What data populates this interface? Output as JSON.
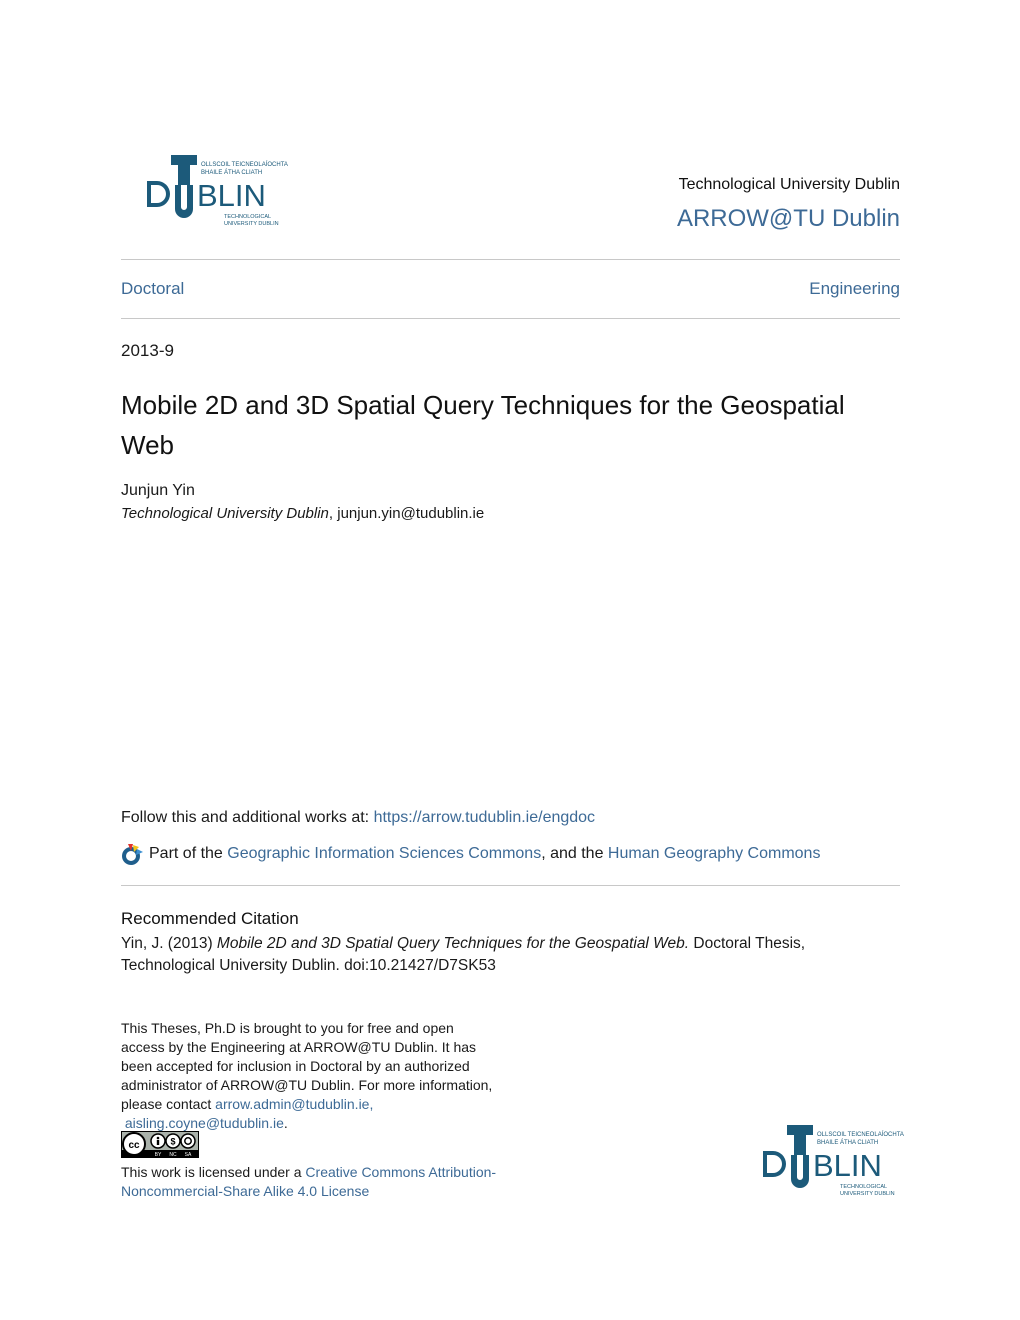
{
  "header": {
    "logo": {
      "icon": "tu-dublin-logo",
      "wordmark": "DUBLIN",
      "irish_line_1": "OLLSCOIL TEICNEOLAÍOCHTA",
      "irish_line_2": "BHAILE ÁTHA CLIATH",
      "english_line_1": "TECHNOLOGICAL",
      "english_line_2": "UNIVERSITY DUBLIN",
      "brand_color": "#1c5a7a"
    },
    "institution": "Technological University Dublin",
    "repository": "ARROW@TU Dublin"
  },
  "nav": {
    "left": "Doctoral",
    "right": "Engineering"
  },
  "document": {
    "date": "2013-9",
    "title": "Mobile 2D and 3D Spatial Query Techniques for the Geospatial Web",
    "author": "Junjun Yin",
    "affiliation": "Technological University Dublin",
    "affiliation_sep": ", ",
    "email": "junjun.yin@tudublin.ie"
  },
  "follow": {
    "label": "Follow this and additional works at: ",
    "url": "https://arrow.tudublin.ie/engdoc"
  },
  "part_of": {
    "icon": "digital-commons-network-icon",
    "prefix": "Part of the ",
    "link1": "Geographic Information Sciences Commons",
    "middle": ", and the ",
    "link2": "Human Geography Commons"
  },
  "citation": {
    "heading": "Recommended Citation",
    "prefix": "Yin, J. (2013) ",
    "title_italic": "Mobile 2D and 3D Spatial Query Techniques for the Geospatial Web.",
    "suffix": " Doctoral Thesis, Technological University Dublin. doi:10.21427/D7SK53"
  },
  "access_note": {
    "text": "This Theses, Ph.D is brought to you for free and open access by the Engineering at ARROW@TU Dublin. It has been accepted for inclusion in Doctoral by an authorized administrator of ARROW@TU Dublin. For more information, please contact ",
    "email1": "arrow.admin@tudublin.ie,",
    "sep": " ",
    "email2": "aisling.coyne@tudublin.ie",
    "end": "."
  },
  "cc_badge": {
    "icon": "cc-by-nc-sa-icon",
    "labels": [
      "BY",
      "NC",
      "SA"
    ]
  },
  "license": {
    "prefix": "This work is licensed under a ",
    "link": "Creative Commons Attribution-Noncommercial-Share Alike 4.0 License"
  },
  "colors": {
    "link": "#3d6a96",
    "text": "#1a1a1a",
    "rule": "#c8c8c8"
  }
}
